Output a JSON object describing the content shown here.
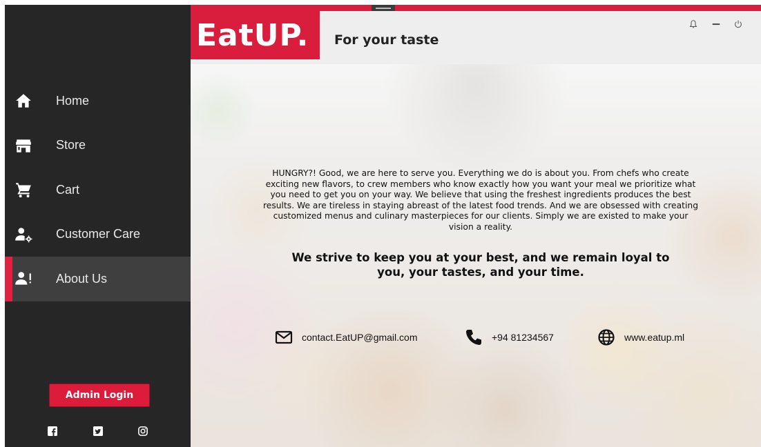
{
  "sidebar": {
    "nav": [
      {
        "label": "Home",
        "icon": "home-icon"
      },
      {
        "label": "Store",
        "icon": "store-icon"
      },
      {
        "label": "Cart",
        "icon": "cart-icon"
      },
      {
        "label": "Customer Care",
        "icon": "user-gear-icon"
      },
      {
        "label": "About Us",
        "icon": "user-info-icon",
        "active": true
      }
    ],
    "admin_button": "Admin Login",
    "social": [
      "facebook-icon",
      "twitter-icon",
      "instagram-icon"
    ]
  },
  "header": {
    "logo": "EatUP.",
    "tagline": "For your taste",
    "window_controls": [
      "bell-icon",
      "minimize-icon",
      "power-icon"
    ]
  },
  "about": {
    "paragraph": "HUNGRY?! Good, we are here to serve you. Everything we do is about you. From chefs who create exciting new flavors, to crew members who know exactly how you want your meal we prioritize what you need to get you on your way. We believe that using the freshest ingredients produces the best results. We are tireless in staying abreast of the latest food trends. And we are obsessed with creating customized menus and culinary masterpieces for our clients. Simply we are existed to make your vision a reality.",
    "motto": "We strive to keep you at your best, and we remain loyal to you, your tastes, and your time."
  },
  "contact": {
    "email": "contact.EatUP@gmail.com",
    "phone": "+94 81234567",
    "website": "www.eatup.ml"
  },
  "colors": {
    "accent": "#d81d3d",
    "sidebar_bg": "#262626",
    "sidebar_active": "#3f3f3f"
  }
}
